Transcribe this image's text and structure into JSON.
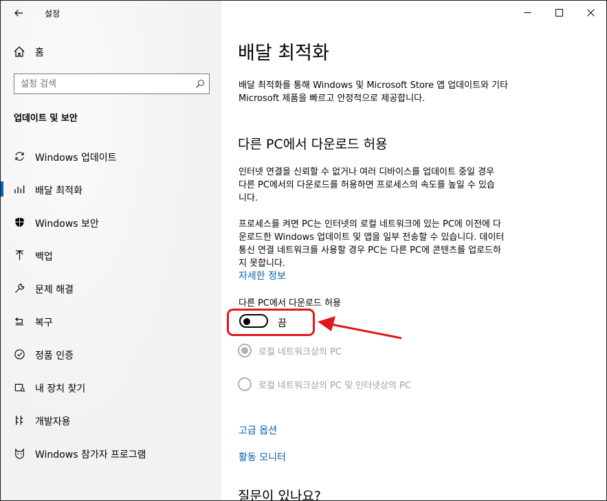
{
  "window": {
    "app_title": "설정",
    "controls": {
      "minimize": "minimize",
      "maximize": "maximize",
      "close": "close"
    }
  },
  "sidebar": {
    "home_label": "홈",
    "search_placeholder": "설정 검색",
    "section_title": "업데이트 및 보안",
    "items": [
      {
        "label": "Windows 업데이트",
        "icon": "sync-icon"
      },
      {
        "label": "배달 최적화",
        "icon": "delivery-optimization-icon",
        "selected": true
      },
      {
        "label": "Windows 보안",
        "icon": "shield-icon"
      },
      {
        "label": "백업",
        "icon": "backup-arrow-icon"
      },
      {
        "label": "문제 해결",
        "icon": "wrench-icon"
      },
      {
        "label": "복구",
        "icon": "recovery-icon"
      },
      {
        "label": "정품 인증",
        "icon": "check-circle-icon"
      },
      {
        "label": "내 장치 찾기",
        "icon": "find-device-icon"
      },
      {
        "label": "개발자용",
        "icon": "developer-icon"
      },
      {
        "label": "Windows 참가자 프로그램",
        "icon": "insider-cat-icon"
      }
    ]
  },
  "main": {
    "title": "배달 최적화",
    "intro_lines": [
      "배달 최적화를 통해 Windows 및 Microsoft Store 앱 업데이트와 기타",
      "Microsoft 제품을 빠르고 안정적으로 제공합니다."
    ],
    "allow_section_title": "다른 PC에서 다운로드 허용",
    "desc1_lines": [
      "인터넷 연결을 신뢰할 수 없거나 여러 디바이스를 업데이트 중일 경우",
      "다른 PC에서의 다운로드를 허용하면 프로세스의 속도를 높일 수 있습",
      "니다."
    ],
    "desc2_lines": [
      "프로세스를 켜면 PC는 인터넷의 로컬 네트워크에 있는 PC에 이전에 다",
      "운로드한 Windows 업데이트 및 앱을 일부 전송할 수 있습니다. 데이터",
      "통신 연결 네트워크를 사용할 경우 PC는 다른 PC에 콘텐츠를 업로드하",
      "지 못합니다."
    ],
    "more_info_link": "자세한 정보",
    "toggle_label": "다른 PC에서 다운로드 허용",
    "toggle_state": "끔",
    "toggle_on": false,
    "radio_options": [
      {
        "label": "로컬 네트워크상의 PC",
        "selected": true,
        "disabled": true
      },
      {
        "label": "로컬 네트워크상의 PC 및 인터넷상의 PC",
        "selected": false,
        "disabled": true
      }
    ],
    "advanced_link": "고급 옵션",
    "monitor_link": "활동 모니터",
    "faq_title": "질문이 있나요?"
  },
  "colors": {
    "accent": "#0063b1",
    "highlight": "#e3141c",
    "sidebar_bg": "#f2f2f2"
  }
}
